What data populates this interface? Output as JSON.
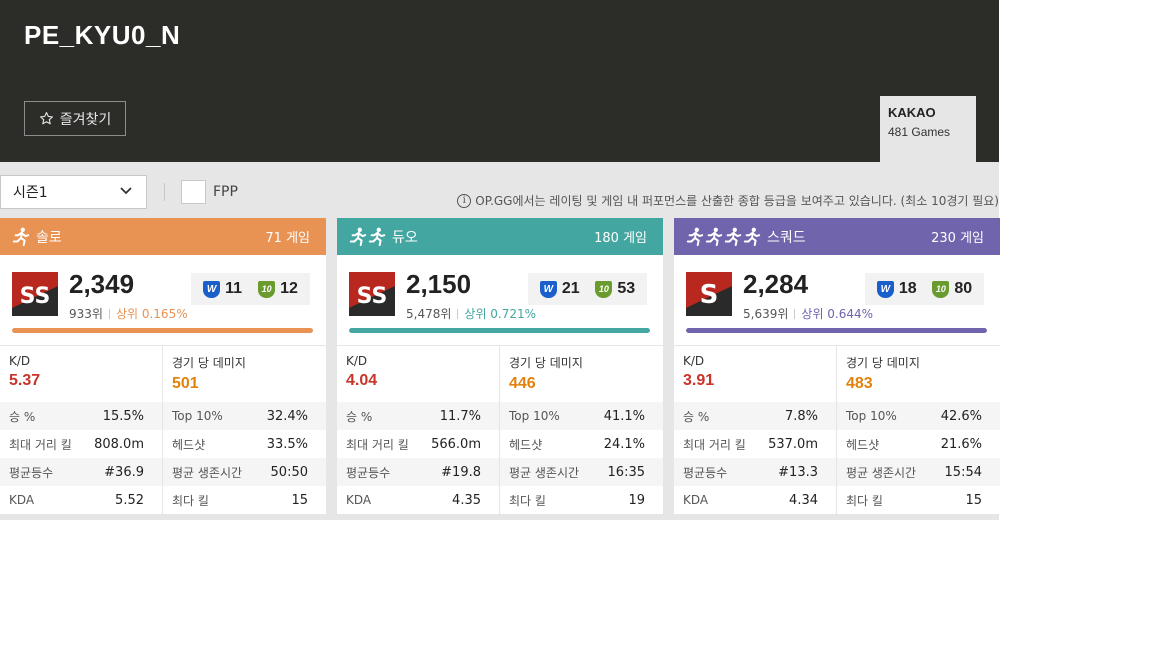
{
  "player": {
    "name": "PE_KYU0_N",
    "favorite_label": "즐겨찾기"
  },
  "server": {
    "name": "KAKAO",
    "games": "481 Games"
  },
  "filters": {
    "season": "시즌1",
    "fpp_label": "FPP",
    "info": "OP.GG에서는 레이팅 및 게임 내 퍼포먼스를 산출한 종합 등급을 보여주고 있습니다. (최소 10경기 필요)"
  },
  "colors": {
    "solo": "#e89254",
    "duo": "#44a6a0",
    "squad": "#7064ad",
    "kd": "#c8342a",
    "damage": "#e2820c"
  },
  "cards": [
    {
      "mode": "솔로",
      "icon": "solo-runner-icon",
      "games": "71 게임",
      "tier": "SS",
      "rating": "2,349",
      "rank": "933위",
      "top_percent": "상위 0.165%",
      "medal_w": "11",
      "medal_10": "12",
      "progress": 1.0,
      "kd_label": "K/D",
      "kd": "5.37",
      "damage_label": "경기 당 데미지",
      "damage": "501",
      "rows": [
        {
          "l1": "승 %",
          "v1": "15.5%",
          "l2": "Top 10%",
          "v2": "32.4%"
        },
        {
          "l1": "최대 거리 킬",
          "v1": "808.0m",
          "l2": "헤드샷",
          "v2": "33.5%"
        },
        {
          "l1": "평균등수",
          "v1": "#36.9",
          "l2": "평균 생존시간",
          "v2": "50:50"
        },
        {
          "l1": "KDA",
          "v1": "5.52",
          "l2": "최다 킬",
          "v2": "15"
        }
      ]
    },
    {
      "mode": "듀오",
      "icon": "duo-runners-icon",
      "games": "180 게임",
      "tier": "SS",
      "rating": "2,150",
      "rank": "5,478위",
      "top_percent": "상위 0.721%",
      "medal_w": "21",
      "medal_10": "53",
      "progress": 1.0,
      "kd_label": "K/D",
      "kd": "4.04",
      "damage_label": "경기 당 데미지",
      "damage": "446",
      "rows": [
        {
          "l1": "승 %",
          "v1": "11.7%",
          "l2": "Top 10%",
          "v2": "41.1%"
        },
        {
          "l1": "최대 거리 킬",
          "v1": "566.0m",
          "l2": "헤드샷",
          "v2": "24.1%"
        },
        {
          "l1": "평균등수",
          "v1": "#19.8",
          "l2": "평균 생존시간",
          "v2": "16:35"
        },
        {
          "l1": "KDA",
          "v1": "4.35",
          "l2": "최다 킬",
          "v2": "19"
        }
      ]
    },
    {
      "mode": "스쿼드",
      "icon": "squad-runners-icon",
      "games": "230 게임",
      "tier": "S",
      "rating": "2,284",
      "rank": "5,639위",
      "top_percent": "상위 0.644%",
      "medal_w": "18",
      "medal_10": "80",
      "progress": 1.0,
      "kd_label": "K/D",
      "kd": "3.91",
      "damage_label": "경기 당 데미지",
      "damage": "483",
      "rows": [
        {
          "l1": "승 %",
          "v1": "7.8%",
          "l2": "Top 10%",
          "v2": "42.6%"
        },
        {
          "l1": "최대 거리 킬",
          "v1": "537.0m",
          "l2": "헤드샷",
          "v2": "21.6%"
        },
        {
          "l1": "평균등수",
          "v1": "#13.3",
          "l2": "평균 생존시간",
          "v2": "15:54"
        },
        {
          "l1": "KDA",
          "v1": "4.34",
          "l2": "최다 킬",
          "v2": "15"
        }
      ]
    }
  ]
}
